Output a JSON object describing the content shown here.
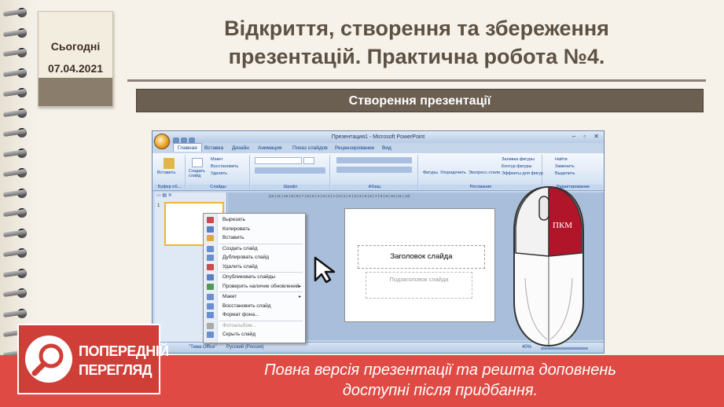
{
  "date_tag": {
    "today_label": "Сьогодні",
    "date": "07.04.2021"
  },
  "title": {
    "line1": "Відкриття, створення та збереження",
    "line2": "презентацій. Практична робота №4."
  },
  "banner": "Створення презентації",
  "powerpoint": {
    "window_title": "Презентация1 - Microsoft PowerPoint",
    "tabs": [
      "Главная",
      "Вставка",
      "Дизайн",
      "Анимация",
      "Показ слайдов",
      "Рецензирование",
      "Вид"
    ],
    "ribbon": {
      "paste": "Вставить",
      "create_slide": "Создать слайд",
      "layout": "Макет",
      "restore": "Восстановить",
      "delete": "Удалить",
      "shapes": "Фигуры",
      "arrange": "Упорядочить",
      "quick_styles": "Экспресс-стили",
      "fill": "Заливка фигуры",
      "outline": "Контур фигуры",
      "effects": "Эффекты для фигур",
      "find": "Найти",
      "replace": "Заменить",
      "select": "Выделить",
      "group_clipboard": "Буфер об...",
      "group_slides": "Слайды",
      "group_font": "Шрифт",
      "group_paragraph": "Абзац",
      "group_drawing": "Рисование",
      "group_editing": "Редактирование"
    },
    "thumb_number": "1",
    "context_menu": [
      {
        "label": "Вырезать",
        "enabled": true
      },
      {
        "label": "Копировать",
        "enabled": true
      },
      {
        "label": "Вставить",
        "enabled": true
      },
      {
        "label": "Создать слайд",
        "enabled": true
      },
      {
        "label": "Дублировать слайд",
        "enabled": true
      },
      {
        "label": "Удалить слайд",
        "enabled": true
      },
      {
        "label": "Опубликовать слайды",
        "enabled": true
      },
      {
        "label": "Проверить наличие обновлений",
        "enabled": true,
        "submenu": true
      },
      {
        "label": "Макет",
        "enabled": true,
        "submenu": true
      },
      {
        "label": "Восстановить слайд",
        "enabled": true
      },
      {
        "label": "Формат фона...",
        "enabled": true
      },
      {
        "label": "Фотоальбом...",
        "enabled": false
      },
      {
        "label": "Скрыть слайд",
        "enabled": true
      }
    ],
    "slide": {
      "title_placeholder": "Заголовок слайда",
      "subtitle_placeholder": "Подзаголовок слайда"
    },
    "status": {
      "theme": "\"Тема Office\"",
      "language": "Русский (Россия)",
      "zoom": "40%"
    }
  },
  "mouse_label": "ПКМ",
  "preview": {
    "line1": "ПОПЕРЕДНІЙ",
    "line2": "ПЕРЕГЛЯД",
    "band_line1": "Повна версія презентації та решта доповнень",
    "band_line2": "доступні після придбання."
  },
  "colors": {
    "title": "#5d5143",
    "banner": "#6b5f52",
    "preview_red": "#e04a44",
    "mouse_button": "#b0152a"
  }
}
